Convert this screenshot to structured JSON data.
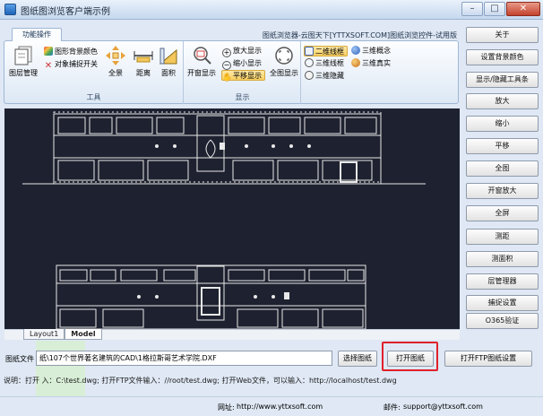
{
  "window": {
    "title": "图纸图浏览客户端示例",
    "buttons": [
      "–",
      "□",
      "✕"
    ]
  },
  "ribbon": {
    "tab": "功能操作",
    "product_title": "图纸浏览器-云图天下[YTTXSOFT.COM]图纸浏览控件-试用版",
    "tools_group": {
      "name": "工具",
      "layer_manager": "图层管理",
      "bg_color": "图形背景颜色",
      "snap_toggle": "对象捕捉开关",
      "full_view": "全景",
      "distance": "距离",
      "area": "面积"
    },
    "display_group": {
      "name": "显示",
      "open_display": "开窗显示",
      "zoom_in": "放大显示",
      "zoom_out": "缩小显示",
      "pan": "平移显示",
      "full_display": "全图显示",
      "wire_2d": "二维线框",
      "wire_3d": "三维线框",
      "hidden_3d": "三维隐藏",
      "concept_3d": "三维概念",
      "real_3d": "三维真实"
    }
  },
  "right_buttons": [
    "关于",
    "设置背景颜色",
    "显示/隐藏工具条",
    "放大",
    "缩小",
    "平移",
    "全图",
    "开窗放大",
    "全屏",
    "测距",
    "测面积",
    "层管理器",
    "捕捉设置",
    "O365验证"
  ],
  "layout_tabs": [
    "Layout1",
    "Model"
  ],
  "file_row": {
    "label": "图纸文件",
    "path": "纸\\107个世界著名建筑的CAD\\1格拉斯哥艺术学院.DXF",
    "select_button": "选择图纸",
    "open_button": "打开图纸",
    "open_ftp_button": "打开FTP图纸设置"
  },
  "hint": "说明：打开        入：C:\\test.dwg;  打开FTP文件输入：//root/test.dwg;  打开Web文件，可以输入：http://localhost/test.dwg",
  "footer": {
    "website_label": "网址:",
    "website": "http://www.yttxsoft.com",
    "email_label": "邮件:",
    "email": "support@yttxsoft.com"
  },
  "colors": {
    "canvas_bg": "#1e2230",
    "highlight": "#e0202b"
  }
}
